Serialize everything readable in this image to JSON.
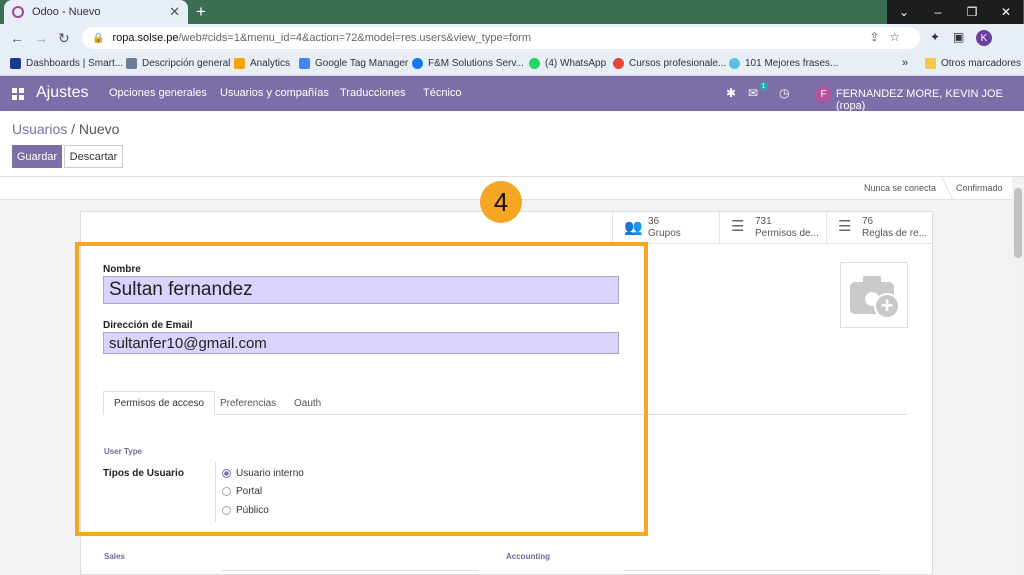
{
  "browser": {
    "tab_title": "Odoo - Nuevo",
    "tab_close": "✕",
    "new_tab": "+",
    "window_controls": [
      "⌄",
      "–",
      "❐",
      "✕"
    ],
    "url_host": "ropa.solse.pe",
    "url_path": "/web#cids=1&menu_id=4&action=72&model=res.users&view_type=form",
    "profile_initial": "K",
    "bookmarks": [
      {
        "label": "Dashboards | Smart...",
        "color": "#1a3a8a"
      },
      {
        "label": "Descripción general",
        "color": "#6b7c93"
      },
      {
        "label": "Analytics",
        "color": "#f4a300"
      },
      {
        "label": "Google Tag Manager",
        "color": "#4285f4"
      },
      {
        "label": "F&M Solutions Serv...",
        "color": "#1877f2"
      },
      {
        "label": "(4) WhatsApp",
        "color": "#25d366"
      },
      {
        "label": "Cursos profesionale...",
        "color": "#ea4335"
      },
      {
        "label": "101 Mejores frases...",
        "color": "#5bc0de"
      }
    ],
    "bookmarks_more": "»",
    "other_bookmarks": "Otros marcadores"
  },
  "odoo": {
    "app_name": "Ajustes",
    "menu": [
      "Opciones generales",
      "Usuarios y compañías",
      "Traducciones",
      "Técnico"
    ],
    "messages_count": "1",
    "user_initial": "F",
    "user_name": "FERNANDEZ MORE, KEVIN JOE (ropa)"
  },
  "control_panel": {
    "breadcrumb_parent": "Usuarios",
    "breadcrumb_sep": " / ",
    "breadcrumb_current": "Nuevo",
    "save_label": "Guardar",
    "discard_label": "Descartar"
  },
  "status": {
    "never_connected": "Nunca se conecta",
    "confirmed": "Confirmado"
  },
  "smart_buttons": [
    {
      "count": "36",
      "label": "Grupos"
    },
    {
      "count": "731",
      "label": "Permisos de..."
    },
    {
      "count": "76",
      "label": "Reglas de re..."
    }
  ],
  "form": {
    "name_label": "Nombre",
    "name_value": "Sultan fernandez",
    "email_label": "Dirección de Email",
    "email_value": "sultanfer10@gmail.com",
    "tabs": [
      "Permisos de acceso",
      "Preferencias",
      "Oauth"
    ],
    "user_type_group": "User Type",
    "user_type_label": "Tipos de Usuario",
    "user_type_options": [
      "Usuario interno",
      "Portal",
      "Público"
    ],
    "user_type_selected": 0,
    "sales_group": "Sales",
    "accounting_group": "Accounting"
  },
  "tutorial": {
    "step_number": "4",
    "highlight_color": "#f5a623"
  }
}
